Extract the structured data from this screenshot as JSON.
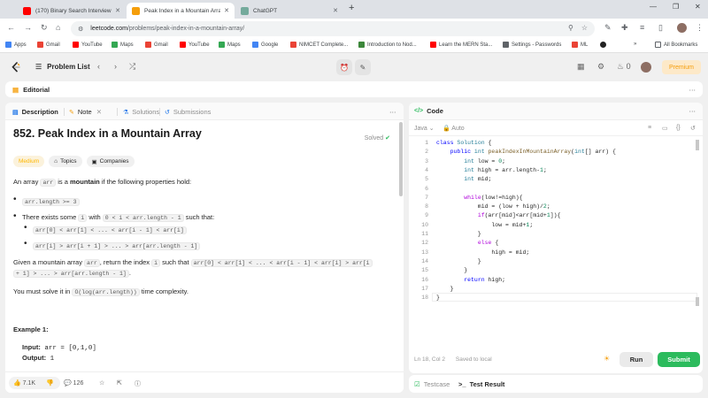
{
  "browser": {
    "tabs": [
      {
        "title": "(170) Binary Search Interview G",
        "favicon_color": "#ff0000"
      },
      {
        "title": "Peak Index in a Mountain Array",
        "favicon_color": "#f59e0b"
      },
      {
        "title": "ChatGPT",
        "favicon_color": "#74aa9c"
      }
    ],
    "url_host": "leetcode.com",
    "url_path": "/problems/peak-index-in-a-mountain-array/",
    "bookmarks": [
      {
        "label": "Apps",
        "color": "#4285f4"
      },
      {
        "label": "Gmail",
        "color": "#ea4335"
      },
      {
        "label": "YouTube",
        "color": "#ff0000"
      },
      {
        "label": "Maps",
        "color": "#34a853"
      },
      {
        "label": "Gmail",
        "color": "#ea4335"
      },
      {
        "label": "YouTube",
        "color": "#ff0000"
      },
      {
        "label": "Maps",
        "color": "#34a853"
      },
      {
        "label": "Google",
        "color": "#4285f4"
      },
      {
        "label": "NIMCET Complete...",
        "color": "#ea4335"
      },
      {
        "label": "Introduction to Nod...",
        "color": "#3c873a"
      },
      {
        "label": "Learn the MERN Sta...",
        "color": "#ff0000"
      },
      {
        "label": "Settings - Passwords",
        "color": "#5f6368"
      },
      {
        "label": "ML",
        "color": "#ea4335"
      }
    ],
    "all_bookmarks": "All Bookmarks"
  },
  "header": {
    "problem_list": "Problem List",
    "streak": "0",
    "premium": "Premium"
  },
  "editorial": {
    "label": "Editorial"
  },
  "left_tabs": {
    "description": "Description",
    "note": "Note",
    "solutions": "Solutions",
    "submissions": "Submissions"
  },
  "problem": {
    "title": "852. Peak Index in a Mountain Array",
    "status": "Solved",
    "difficulty": "Medium",
    "tags_label": "Topics",
    "companies_label": "Companies",
    "intro_pre": "An array ",
    "intro_code": "arr",
    "intro_mid": " is a ",
    "intro_bold": "mountain",
    "intro_post": " if the following properties hold:",
    "bullet1_code": "arr.length >= 3",
    "bullet2_pre": "There exists some ",
    "bullet2_code1": "i",
    "bullet2_mid": " with ",
    "bullet2_code2": "0 < i < arr.length - 1",
    "bullet2_post": " such that:",
    "sub1_code": "arr[0] < arr[1] < ... < arr[i - 1] < arr[i]",
    "sub2_code": "arr[i] > arr[i + 1] > ... > arr[arr.length - 1]",
    "given_pre": "Given a mountain array ",
    "given_code1": "arr",
    "given_mid": ", return the index ",
    "given_code2": "i",
    "given_mid2": " such that ",
    "given_code3": "arr[0] < arr[1] < ... < arr[i - 1] < arr[i] > arr[i",
    "given_code4": "+ 1] > ... > arr[arr.length - 1]",
    "given_post": ".",
    "solve_pre": "You must solve it in ",
    "solve_code": "O(log(arr.length))",
    "solve_post": " time complexity.",
    "example_title": "Example 1:",
    "input_label": "Input:",
    "input_value": "arr = [0,1,0]",
    "output_label": "Output:",
    "output_value": "1"
  },
  "footer": {
    "likes": "7.1K",
    "comments": "126"
  },
  "code_panel": {
    "title": "Code",
    "language": "Java",
    "mode": "Auto",
    "status_pos": "Ln 18, Col 2",
    "status_saved": "Saved to local",
    "run": "Run",
    "submit": "Submit"
  },
  "code_lines": [
    "class Solution {",
    "    public int peakIndexInMountainArray(int[] arr) {",
    "        int low = 0;",
    "        int high = arr.length-1;",
    "        int mid;",
    "",
    "        while(low!=high){",
    "            mid = (low + high)/2;",
    "            if(arr[mid]<arr[mid+1]){",
    "                low = mid+1;",
    "            }",
    "            else {",
    "                high = mid;",
    "            }",
    "        }",
    "        return high;",
    "    }",
    "}"
  ],
  "bottom_tabs": {
    "testcase": "Testcase",
    "test_result": "Test Result"
  }
}
